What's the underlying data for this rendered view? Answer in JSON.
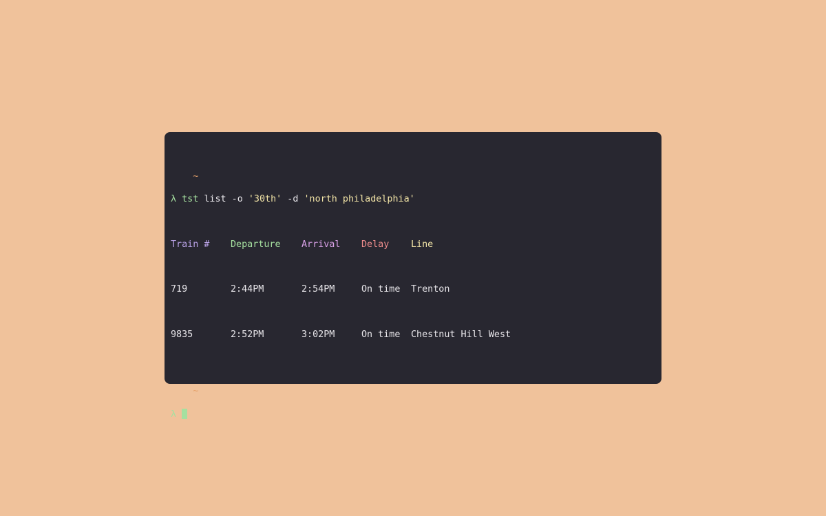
{
  "colors": {
    "background": "#f0c29b",
    "terminal_bg": "#282730",
    "tilde": "#e6a26b",
    "prompt": "#a6e0a0",
    "string": "#f1e3a6"
  },
  "terminal": {
    "dir1": "~",
    "prompt_symbol": "λ",
    "command": {
      "name": "tst",
      "parts": [
        " list -o ",
        "'30th'",
        " -d ",
        "'north philadelphia'"
      ]
    },
    "table": {
      "headers": [
        "Train #",
        "Departure",
        "Arrival",
        "Delay",
        "Line"
      ],
      "rows": [
        [
          "719",
          "2:44PM",
          "2:54PM",
          "On time",
          "Trenton"
        ],
        [
          "9835",
          "2:52PM",
          "3:02PM",
          "On time",
          "Chestnut Hill West"
        ]
      ]
    },
    "dir2": "~",
    "prompt_symbol2": "λ"
  }
}
